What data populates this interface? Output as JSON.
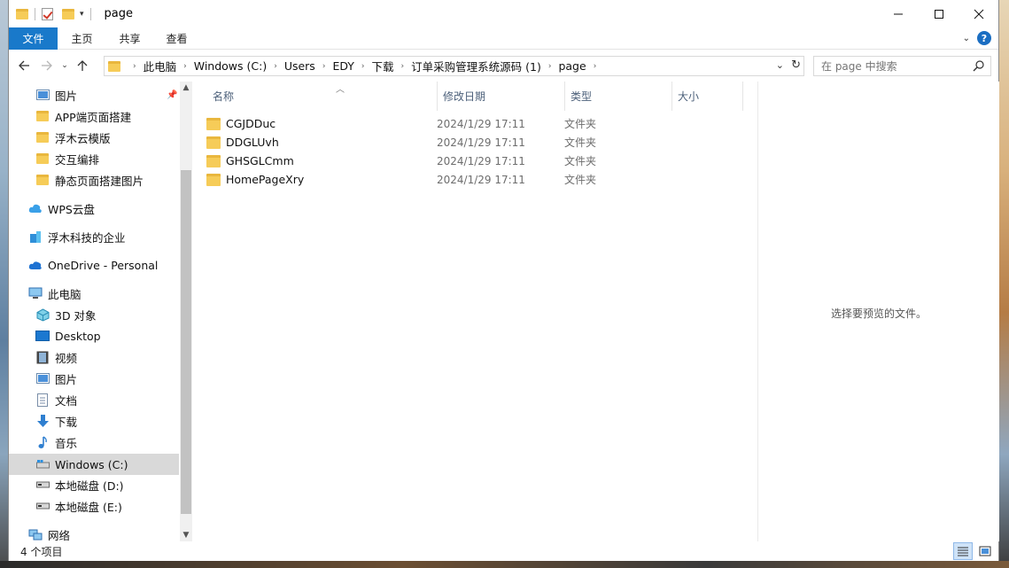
{
  "window": {
    "title": "page"
  },
  "ribbon": {
    "tabs": [
      "文件",
      "主页",
      "共享",
      "查看"
    ]
  },
  "address": {
    "crumbs": [
      "此电脑",
      "Windows (C:)",
      "Users",
      "EDY",
      "下载",
      "订单采购管理系统源码 (1)",
      "page"
    ]
  },
  "search": {
    "placeholder": "在 page 中搜索"
  },
  "nav": {
    "items": [
      {
        "label": "图片",
        "icon": "pictures-icon"
      },
      {
        "label": "APP端页面搭建",
        "icon": "folder-icon"
      },
      {
        "label": "浮木云模版",
        "icon": "folder-icon"
      },
      {
        "label": "交互编排",
        "icon": "folder-icon"
      },
      {
        "label": "静态页面搭建图片",
        "icon": "folder-icon"
      },
      {
        "label": "WPS云盘",
        "icon": "cloud-icon"
      },
      {
        "label": "浮木科技的企业",
        "icon": "enterprise-icon"
      },
      {
        "label": "OneDrive - Personal",
        "icon": "onedrive-icon"
      },
      {
        "label": "此电脑",
        "icon": "computer-icon"
      },
      {
        "label": "3D 对象",
        "icon": "3d-objects-icon"
      },
      {
        "label": "Desktop",
        "icon": "desktop-icon"
      },
      {
        "label": "视频",
        "icon": "video-icon"
      },
      {
        "label": "图片",
        "icon": "pictures-icon"
      },
      {
        "label": "文档",
        "icon": "documents-icon"
      },
      {
        "label": "下载",
        "icon": "download-icon"
      },
      {
        "label": "音乐",
        "icon": "music-icon"
      },
      {
        "label": "Windows (C:)",
        "icon": "drive-icon",
        "selected": true
      },
      {
        "label": "本地磁盘 (D:)",
        "icon": "drive-icon"
      },
      {
        "label": "本地磁盘 (E:)",
        "icon": "drive-icon"
      },
      {
        "label": "网络",
        "icon": "network-icon"
      }
    ]
  },
  "columns": {
    "name": "名称",
    "date": "修改日期",
    "type": "类型",
    "size": "大小"
  },
  "files": [
    {
      "name": "CGJDDuc",
      "date": "2024/1/29 17:11",
      "type": "文件夹"
    },
    {
      "name": "DDGLUvh",
      "date": "2024/1/29 17:11",
      "type": "文件夹"
    },
    {
      "name": "GHSGLCmm",
      "date": "2024/1/29 17:11",
      "type": "文件夹"
    },
    {
      "name": "HomePageXry",
      "date": "2024/1/29 17:11",
      "type": "文件夹"
    }
  ],
  "preview": {
    "message": "选择要预览的文件。"
  },
  "status": {
    "count": "4 个项目"
  },
  "colors": {
    "accent": "#1979ca",
    "selected": "#d9d9d9",
    "folder": "#f6cc58"
  }
}
